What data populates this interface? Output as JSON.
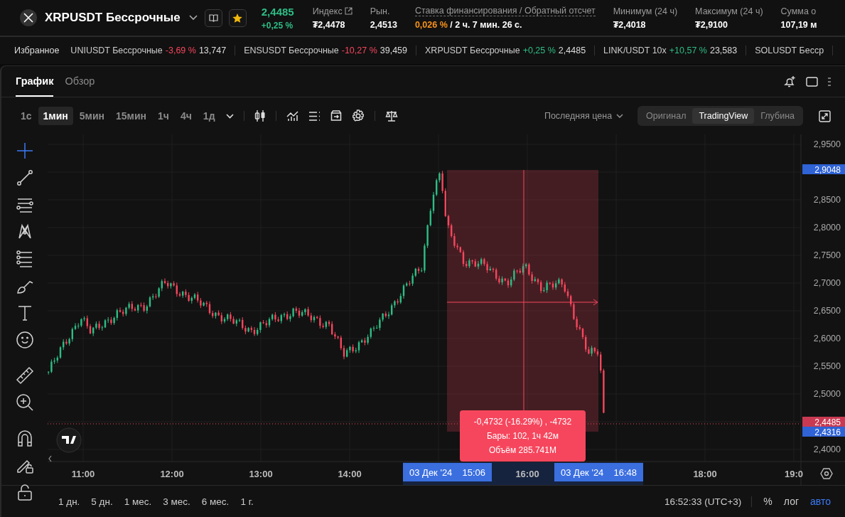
{
  "header": {
    "symbol": "XRPUSDT Бессрочные",
    "price": "2,4485",
    "change": "+0,25 %",
    "stats": [
      {
        "kind": "index",
        "label": "Индекс",
        "value": "₮2,4478"
      },
      {
        "kind": "plain",
        "label": "Рын.",
        "value": "2,4513"
      },
      {
        "kind": "funding",
        "label": "Ставка финансирования / Обратный отсчет",
        "rate": "0,026 %",
        "value": "/ 2 ч. 7 мин. 26 с."
      },
      {
        "kind": "plain",
        "label": "Минимум (24 ч)",
        "value": "₮2,4018"
      },
      {
        "kind": "plain",
        "label": "Максимум (24 ч)",
        "value": "₮2,9100"
      },
      {
        "kind": "plain",
        "label": "Сумма о",
        "value": "107,19 м"
      }
    ]
  },
  "ticker": {
    "label": "Избранное",
    "items": [
      {
        "name": "UNIUSDT Бессрочные",
        "change": "-3,69 %",
        "color": "#f6465d",
        "price": "13,747"
      },
      {
        "name": "ENSUSDT Бессрочные",
        "change": "-10,27 %",
        "color": "#f6465d",
        "price": "39,459"
      },
      {
        "name": "XRPUSDT Бессрочные",
        "change": "+0,25 %",
        "color": "#2ebd85",
        "price": "2,4485"
      },
      {
        "name": "LINK/USDT 10x",
        "change": "+10,57 %",
        "color": "#2ebd85",
        "price": "23,583"
      },
      {
        "name": "SOLUSDT Бесср"
      }
    ]
  },
  "tabs": [
    {
      "label": "График",
      "selected": true
    },
    {
      "label": "Обзор",
      "selected": false
    }
  ],
  "intervals": [
    {
      "label": "1с",
      "selected": false
    },
    {
      "label": "1мин",
      "selected": true
    },
    {
      "label": "5мин",
      "selected": false
    },
    {
      "label": "15мин",
      "selected": false
    },
    {
      "label": "1ч",
      "selected": false
    },
    {
      "label": "4ч",
      "selected": false
    },
    {
      "label": "1д",
      "selected": false
    }
  ],
  "price_source": "Последняя цена",
  "view_modes": [
    {
      "label": "Оригинал",
      "selected": false
    },
    {
      "label": "TradingView",
      "selected": true
    },
    {
      "label": "Глубина",
      "selected": false
    }
  ],
  "tools": [
    {
      "kind": "crosshair",
      "selected": true
    },
    {
      "kind": "line",
      "selected": false
    },
    {
      "kind": "channel",
      "selected": false
    },
    {
      "kind": "pattern",
      "selected": false
    },
    {
      "kind": "fib",
      "selected": false
    },
    {
      "kind": "brush",
      "selected": false
    },
    {
      "kind": "text",
      "selected": false
    },
    {
      "kind": "emoji",
      "selected": false
    },
    {
      "kind": "ruler",
      "selected": false
    },
    {
      "kind": "zoom",
      "selected": false
    },
    {
      "kind": "magnet",
      "selected": false
    },
    {
      "kind": "lockdraw",
      "selected": false
    },
    {
      "kind": "lock",
      "selected": false
    }
  ],
  "chart": {
    "y_labels": [
      "2,9500",
      "2,8500",
      "2,8000",
      "2,7500",
      "2,7000",
      "2,6500",
      "2,6000",
      "2,5500",
      "2,5000",
      "2,4000"
    ],
    "price_badges": [
      {
        "kind": "marker",
        "value": "2,9048"
      },
      {
        "kind": "last",
        "value": "2,4485"
      },
      {
        "kind": "marker",
        "value": "2,4316"
      }
    ],
    "x_labels": [
      "11:00",
      "12:00",
      "13:00",
      "14:00",
      "16:00",
      "18:00",
      "19:0"
    ],
    "time_badges": [
      {
        "date": "03 Дек '24",
        "time": "15:06"
      },
      {
        "date": "03 Дек '24",
        "time": "16:48"
      }
    ],
    "measure": [
      "-0,4732 (-16.29%) , -4732",
      "Бары: 102, 1ч 42м",
      "Объём 285.741M"
    ]
  },
  "ranges": [
    "1 дн.",
    "5 дн.",
    "1 мес.",
    "3 мес.",
    "6 мес.",
    "1 г."
  ],
  "clock": "16:52:33 (UTC+3)",
  "scale_options": [
    {
      "label": "%",
      "selected": false
    },
    {
      "label": "лог",
      "selected": false
    },
    {
      "label": "авто",
      "selected": true
    }
  ]
}
